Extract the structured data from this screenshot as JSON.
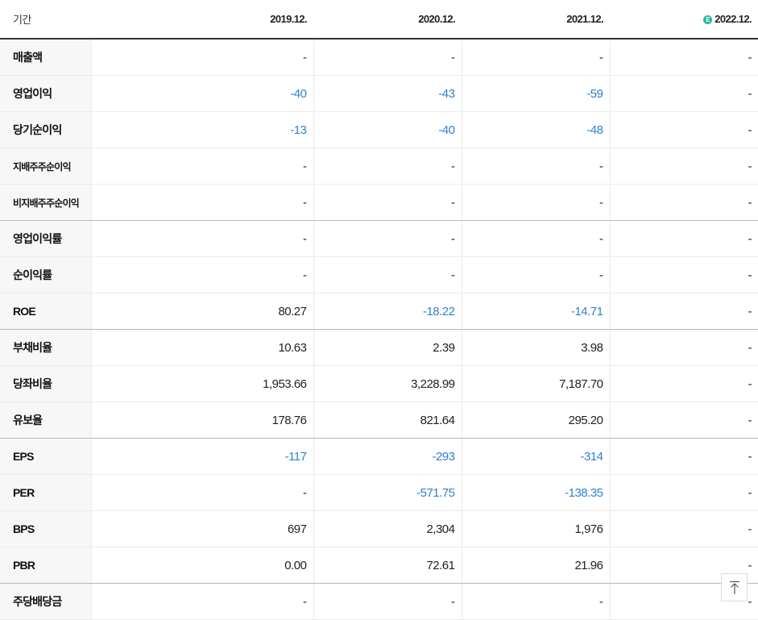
{
  "header": {
    "label": "기간",
    "estimate_mark": "E",
    "columns": [
      "2019.12.",
      "2020.12.",
      "2021.12.",
      "2022.12."
    ]
  },
  "rows": [
    {
      "label": "매출액",
      "values": [
        "-",
        "-",
        "-",
        "-"
      ],
      "negative": [
        false,
        false,
        false,
        false
      ]
    },
    {
      "label": "영업이익",
      "values": [
        "-40",
        "-43",
        "-59",
        "-"
      ],
      "negative": [
        true,
        true,
        true,
        false
      ]
    },
    {
      "label": "당기순이익",
      "values": [
        "-13",
        "-40",
        "-48",
        "-"
      ],
      "negative": [
        true,
        true,
        true,
        false
      ]
    },
    {
      "label": "지배주주순이익",
      "values": [
        "-",
        "-",
        "-",
        "-"
      ],
      "negative": [
        false,
        false,
        false,
        false
      ]
    },
    {
      "label": "비지배주주순이익",
      "values": [
        "-",
        "-",
        "-",
        "-"
      ],
      "negative": [
        false,
        false,
        false,
        false
      ]
    },
    {
      "label": "영업이익률",
      "values": [
        "-",
        "-",
        "-",
        "-"
      ],
      "negative": [
        false,
        false,
        false,
        false
      ]
    },
    {
      "label": "순이익률",
      "values": [
        "-",
        "-",
        "-",
        "-"
      ],
      "negative": [
        false,
        false,
        false,
        false
      ]
    },
    {
      "label": "ROE",
      "values": [
        "80.27",
        "-18.22",
        "-14.71",
        "-"
      ],
      "negative": [
        false,
        true,
        true,
        false
      ]
    },
    {
      "label": "부채비율",
      "values": [
        "10.63",
        "2.39",
        "3.98",
        "-"
      ],
      "negative": [
        false,
        false,
        false,
        false
      ]
    },
    {
      "label": "당좌비율",
      "values": [
        "1,953.66",
        "3,228.99",
        "7,187.70",
        "-"
      ],
      "negative": [
        false,
        false,
        false,
        false
      ]
    },
    {
      "label": "유보율",
      "values": [
        "178.76",
        "821.64",
        "295.20",
        "-"
      ],
      "negative": [
        false,
        false,
        false,
        false
      ]
    },
    {
      "label": "EPS",
      "values": [
        "-117",
        "-293",
        "-314",
        "-"
      ],
      "negative": [
        true,
        true,
        true,
        false
      ]
    },
    {
      "label": "PER",
      "values": [
        "-",
        "-571.75",
        "-138.35",
        "-"
      ],
      "negative": [
        false,
        true,
        true,
        false
      ]
    },
    {
      "label": "BPS",
      "values": [
        "697",
        "2,304",
        "1,976",
        "-"
      ],
      "negative": [
        false,
        false,
        false,
        false
      ]
    },
    {
      "label": "PBR",
      "values": [
        "0.00",
        "72.61",
        "21.96",
        "-"
      ],
      "negative": [
        false,
        false,
        false,
        false
      ]
    },
    {
      "label": "주당배당금",
      "values": [
        "-",
        "-",
        "-",
        "-"
      ],
      "negative": [
        false,
        false,
        false,
        false
      ]
    }
  ],
  "colors": {
    "negative": "#2f7fd1",
    "label_bg": "#f7f7f7",
    "estimate_badge": "#27b59d"
  },
  "icons": {
    "top_button": "arrow-up-to-top-icon",
    "estimate": "estimate-badge-icon"
  }
}
